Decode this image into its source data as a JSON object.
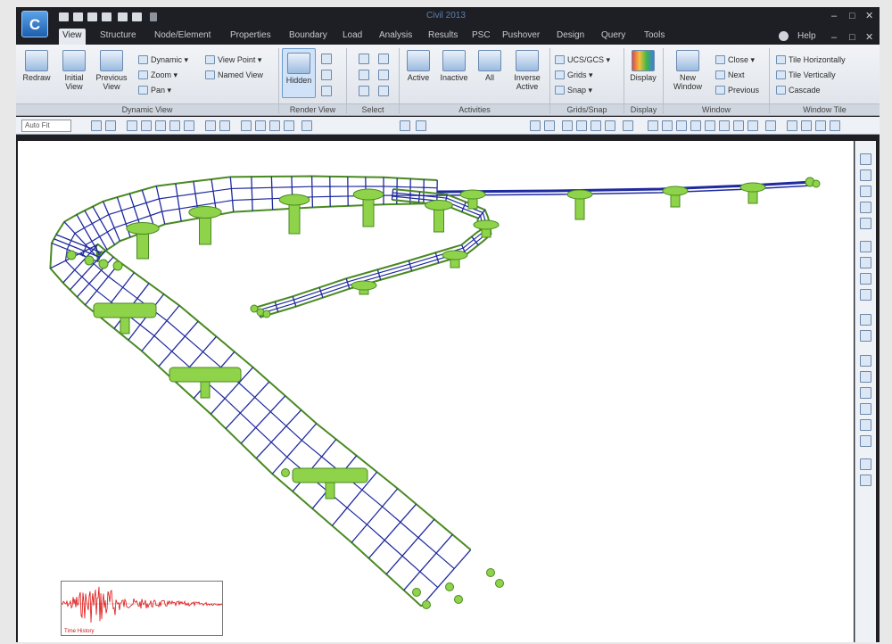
{
  "window": {
    "title": "Civil 2013"
  },
  "quick_access": [
    "new-file-icon",
    "open-folder-icon",
    "save-icon",
    "save-as-icon",
    "print-icon",
    "print-preview-icon"
  ],
  "tabs": [
    "View",
    "Structure",
    "Node/Element",
    "Properties",
    "Boundary",
    "Load",
    "Analysis",
    "Results",
    "PSC",
    "Pushover",
    "Design",
    "Query",
    "Tools"
  ],
  "active_tab": "View",
  "help_label": "Help",
  "ribbon": {
    "dynamic_view": {
      "label": "Dynamic View",
      "redraw": "Redraw",
      "initial_view": "Initial View",
      "previous_view": "Previous View",
      "dynamic": "Dynamic",
      "zoom": "Zoom",
      "pan": "Pan",
      "view_point": "View Point",
      "named_view": "Named View"
    },
    "render_view": {
      "label": "Render View",
      "hidden": "Hidden"
    },
    "select": {
      "label": "Select"
    },
    "activities": {
      "label": "Activities",
      "active": "Active",
      "inactive": "Inactive",
      "all": "All",
      "inverse_active": "Inverse Active"
    },
    "grids_snap": {
      "label": "Grids/Snap",
      "ucs": "UCS/GCS",
      "grids": "Grids",
      "snap": "Snap"
    },
    "display": {
      "label": "Display",
      "display": "Display"
    },
    "window": {
      "label": "Window",
      "new_window": "New Window",
      "close": "Close",
      "next": "Next",
      "previous": "Previous"
    },
    "window_tile": {
      "label": "Window Tile",
      "tile_h": "Tile Horizontally",
      "tile_v": "Tile Vertically",
      "cascade": "Cascade"
    }
  },
  "toolbar": {
    "zoom_value": "Auto Fit"
  },
  "inset": {
    "label": "Time History"
  },
  "colors": {
    "deck_line": "#1f2a9e",
    "support": "#8fd34a",
    "support_outline": "#4a8a22",
    "signal": "#e01010"
  }
}
